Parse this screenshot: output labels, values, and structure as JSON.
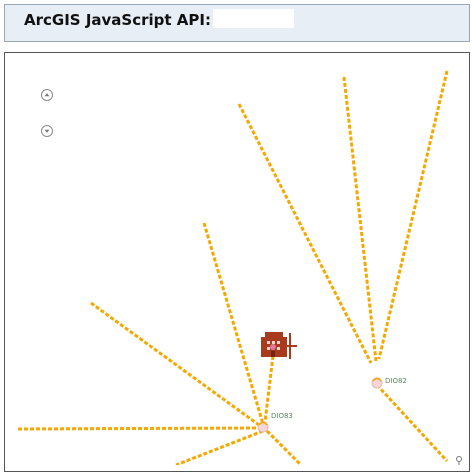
{
  "header": {
    "title": "ArcGIS JavaScript API:",
    "input_value": ""
  },
  "map": {
    "zoom_in_icon": "chevron-up-icon",
    "zoom_out_icon": "chevron-down-icon",
    "line_color": "#f5a800",
    "building_color": "#a83a1e",
    "nodes": [
      {
        "label": "DIO82"
      },
      {
        "label": "DIO83"
      }
    ]
  }
}
